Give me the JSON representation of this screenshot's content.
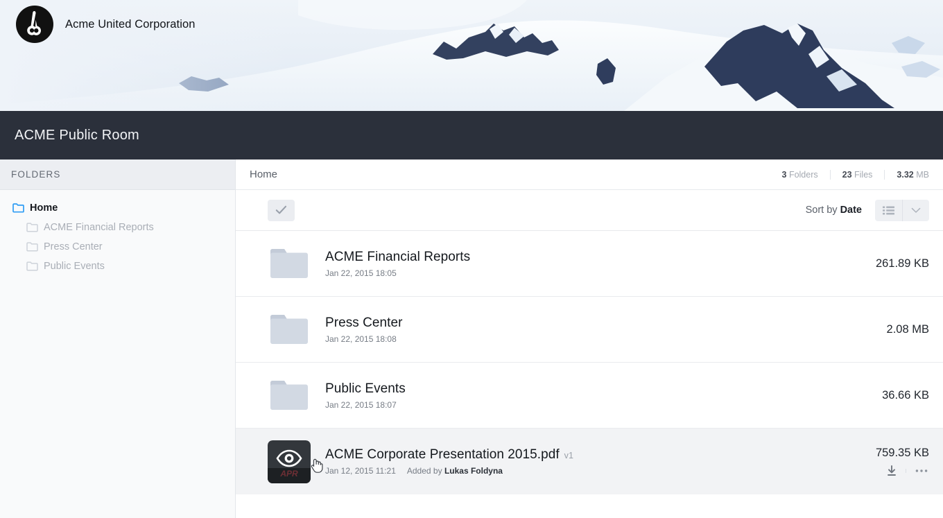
{
  "brand": {
    "logo_icon": "acme-circle-logo",
    "name": "Acme United Corporation"
  },
  "banner": {
    "image_alt": "snowy-mountain-photo"
  },
  "titlebar": {
    "title": "ACME Public Room",
    "background": "#2b303b"
  },
  "sidebar": {
    "header": "FOLDERS",
    "items": [
      {
        "label": "Home",
        "icon": "folder-icon",
        "active": true,
        "level": 0
      },
      {
        "label": "ACME Financial Reports",
        "icon": "folder-icon",
        "active": false,
        "level": 1
      },
      {
        "label": "Press Center",
        "icon": "folder-icon",
        "active": false,
        "level": 1
      },
      {
        "label": "Public Events",
        "icon": "folder-icon",
        "active": false,
        "level": 1
      }
    ],
    "active_color": "#2e9cf4",
    "inactive_color": "#cdd2d9"
  },
  "breadcrumb": {
    "current": "Home"
  },
  "stats": [
    {
      "value": "3",
      "label": "Folders"
    },
    {
      "value": "23",
      "label": "Files"
    },
    {
      "value": "3.32",
      "label": "MB"
    }
  ],
  "toolbar": {
    "select_all_icon": "check-icon",
    "sort_prefix": "Sort by",
    "sort_value": "Date",
    "list_view_icon": "list-view-icon",
    "dropdown_icon": "chevron-down-icon"
  },
  "rows": [
    {
      "type": "folder",
      "thumb_icon": "folder-icon",
      "title": "ACME Financial Reports",
      "version": "",
      "date": "Jan 22, 2015 18:05",
      "added_prefix": "",
      "added_by": "",
      "size": "261.89 KB",
      "highlight": false,
      "show_actions": false
    },
    {
      "type": "folder",
      "thumb_icon": "folder-icon",
      "title": "Press Center",
      "version": "",
      "date": "Jan 22, 2015 18:08",
      "added_prefix": "",
      "added_by": "",
      "size": "2.08 MB",
      "highlight": false,
      "show_actions": false
    },
    {
      "type": "folder",
      "thumb_icon": "folder-icon",
      "title": "Public Events",
      "version": "",
      "date": "Jan 22, 2015 18:07",
      "added_prefix": "",
      "added_by": "",
      "size": "36.66 KB",
      "highlight": false,
      "show_actions": false
    },
    {
      "type": "file",
      "thumb_icon": "preview-eye-icon",
      "thumb_caption": "APR",
      "title": "ACME Corporate Presentation 2015.pdf",
      "version": "v1",
      "date": "Jan 12, 2015 11:21",
      "added_prefix": "Added by",
      "added_by": "Lukas Foldyna",
      "size": "759.35 KB",
      "highlight": true,
      "show_actions": true,
      "actions": [
        {
          "icon": "download-icon",
          "label": "Download"
        },
        {
          "icon": "more-options-icon",
          "label": "More"
        }
      ]
    }
  ]
}
